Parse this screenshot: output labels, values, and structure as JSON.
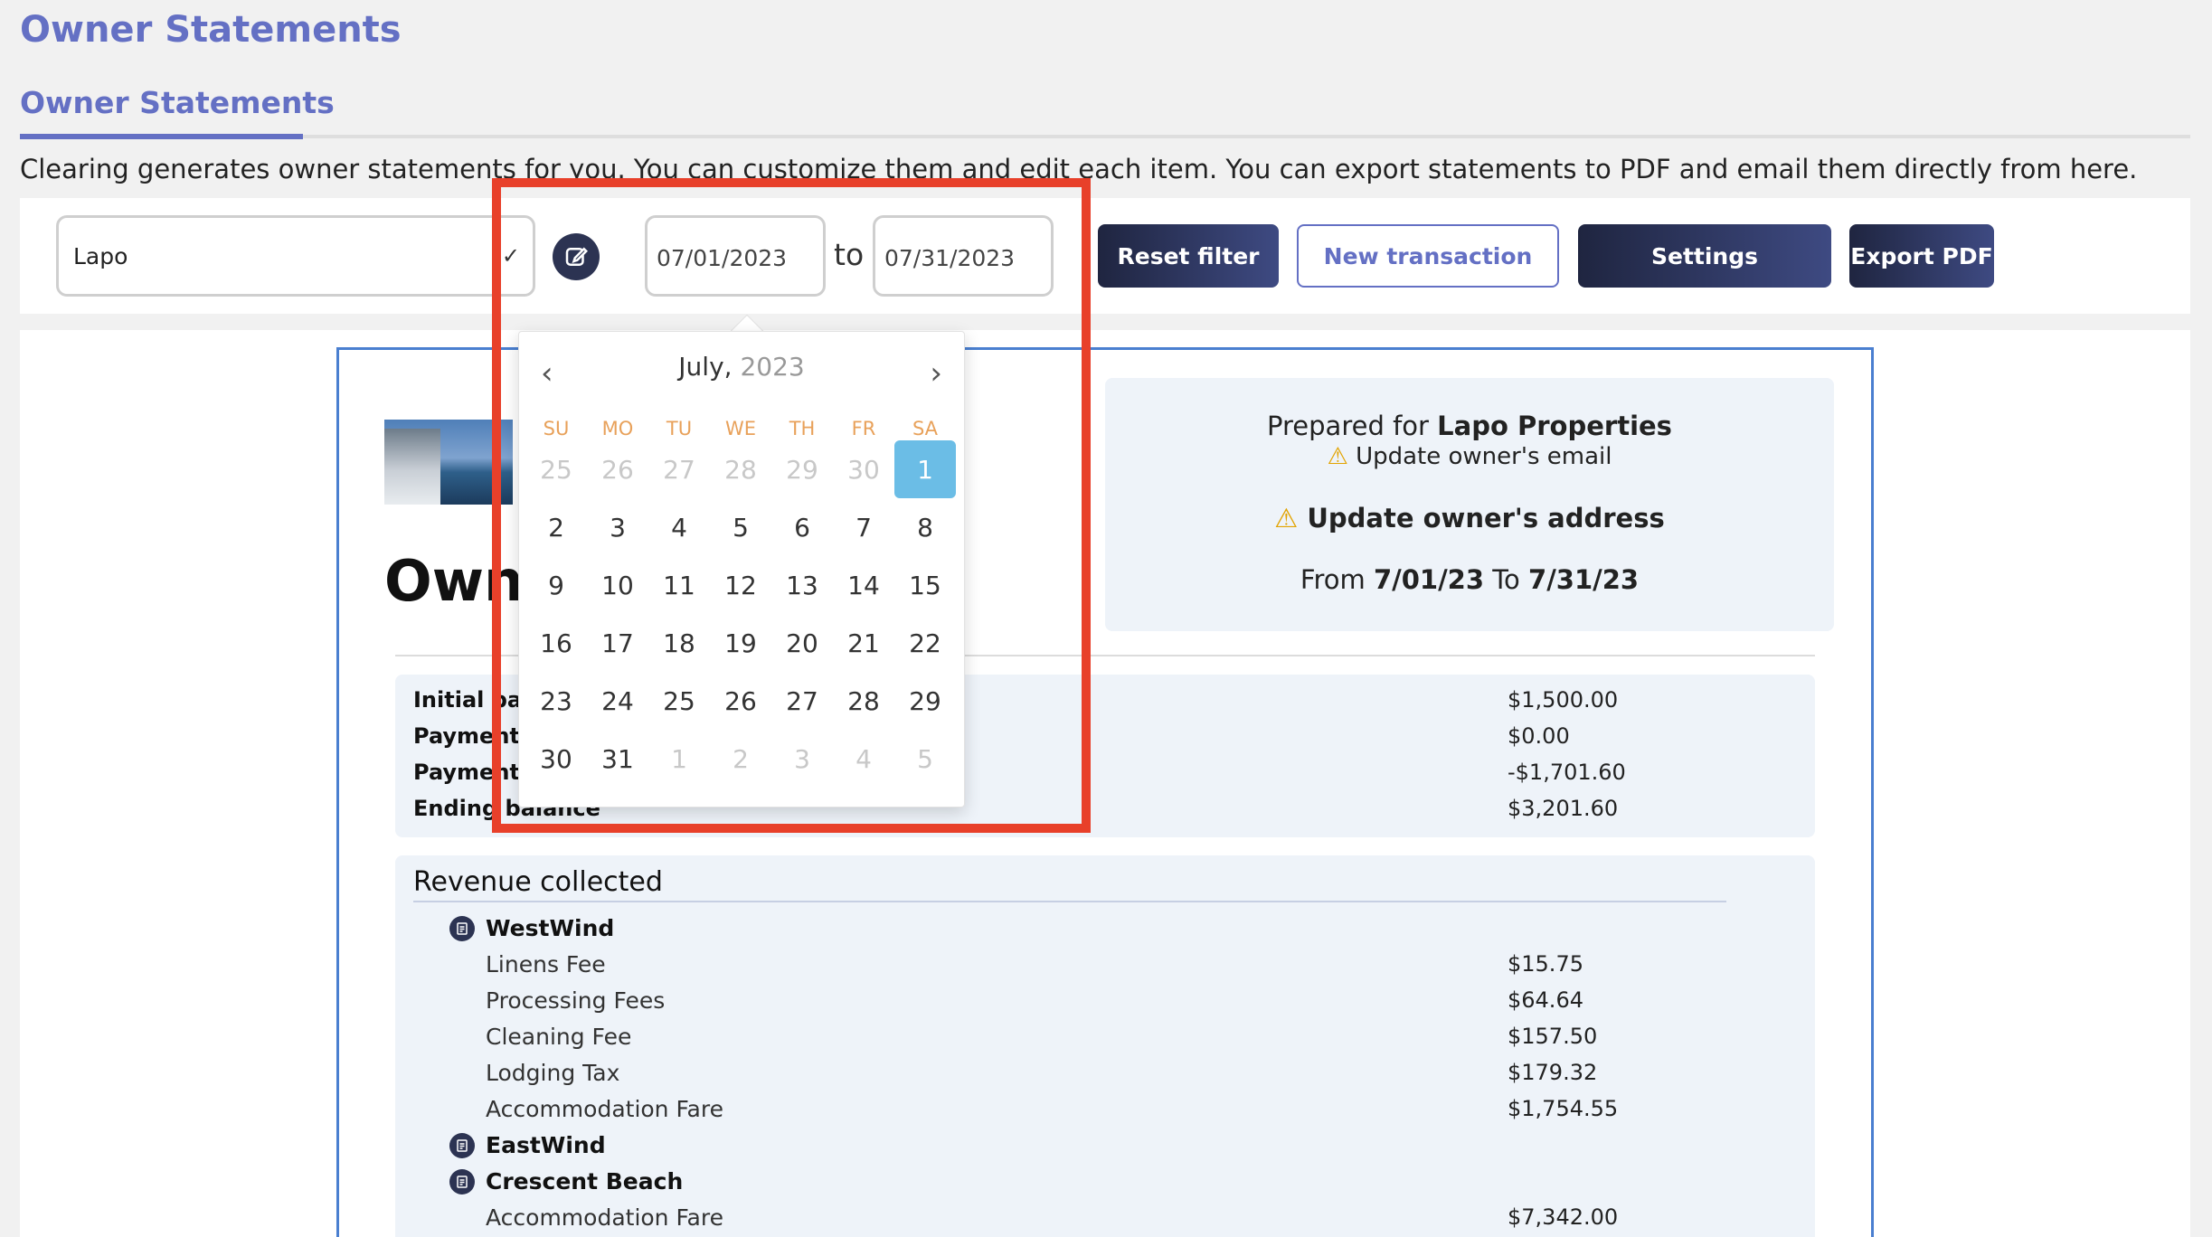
{
  "page": {
    "title": "Owner Statements"
  },
  "tabs": {
    "active": "Owner Statements"
  },
  "description": "Clearing generates owner statements for you. You can customize them and edit each item. You can export statements to PDF and email them directly from here.",
  "filters": {
    "owner": "Lapo",
    "date_from": "07/01/2023",
    "to_label": "to",
    "date_to": "07/31/2023",
    "reset": "Reset filter",
    "new_transaction": "New transaction",
    "settings": "Settings",
    "export": "Export PDF"
  },
  "calendar": {
    "month": "July,",
    "year": "2023",
    "weekdays": [
      "SU",
      "MO",
      "TU",
      "WE",
      "TH",
      "FR",
      "SA"
    ],
    "weeks": [
      [
        {
          "d": "25",
          "m": true
        },
        {
          "d": "26",
          "m": true
        },
        {
          "d": "27",
          "m": true
        },
        {
          "d": "28",
          "m": true
        },
        {
          "d": "29",
          "m": true
        },
        {
          "d": "30",
          "m": true
        },
        {
          "d": "1",
          "sel": true
        }
      ],
      [
        {
          "d": "2"
        },
        {
          "d": "3"
        },
        {
          "d": "4"
        },
        {
          "d": "5"
        },
        {
          "d": "6"
        },
        {
          "d": "7"
        },
        {
          "d": "8"
        }
      ],
      [
        {
          "d": "9"
        },
        {
          "d": "10"
        },
        {
          "d": "11"
        },
        {
          "d": "12"
        },
        {
          "d": "13"
        },
        {
          "d": "14"
        },
        {
          "d": "15"
        }
      ],
      [
        {
          "d": "16"
        },
        {
          "d": "17"
        },
        {
          "d": "18"
        },
        {
          "d": "19"
        },
        {
          "d": "20"
        },
        {
          "d": "21"
        },
        {
          "d": "22"
        }
      ],
      [
        {
          "d": "23"
        },
        {
          "d": "24"
        },
        {
          "d": "25"
        },
        {
          "d": "26"
        },
        {
          "d": "27"
        },
        {
          "d": "28"
        },
        {
          "d": "29"
        }
      ],
      [
        {
          "d": "30"
        },
        {
          "d": "31"
        },
        {
          "d": "1",
          "m": true
        },
        {
          "d": "2",
          "m": true
        },
        {
          "d": "3",
          "m": true
        },
        {
          "d": "4",
          "m": true
        },
        {
          "d": "5",
          "m": true
        }
      ]
    ]
  },
  "statement": {
    "title_partial": "Own",
    "prepared_prefix": "Prepared for ",
    "owner_name": "Lapo Properties",
    "email_warning": "Update owner's email",
    "address_warning": "Update owner's address",
    "from_label": "From ",
    "from_date": "7/01/23",
    "to_label": " To ",
    "to_date": "7/31/23",
    "summary": [
      {
        "label": "Initial bal",
        "amount": "$1,500.00"
      },
      {
        "label": "Payments",
        "amount": "$0.00"
      },
      {
        "label": "Payments",
        "amount": "-$1,701.60"
      },
      {
        "label": "Ending balance",
        "amount": "$3,201.60"
      }
    ],
    "revenue_title": "Revenue collected",
    "properties": [
      {
        "name": "WestWind",
        "items": [
          {
            "name": "Linens Fee",
            "amount": "$15.75"
          },
          {
            "name": "Processing Fees",
            "amount": "$64.64"
          },
          {
            "name": "Cleaning Fee",
            "amount": "$157.50"
          },
          {
            "name": "Lodging Tax",
            "amount": "$179.32"
          },
          {
            "name": "Accommodation Fare",
            "amount": "$1,754.55"
          }
        ]
      },
      {
        "name": "EastWind",
        "items": []
      },
      {
        "name": "Crescent Beach",
        "items": [
          {
            "name": "Accommodation Fare",
            "amount": "$7,342.00"
          }
        ]
      }
    ]
  }
}
